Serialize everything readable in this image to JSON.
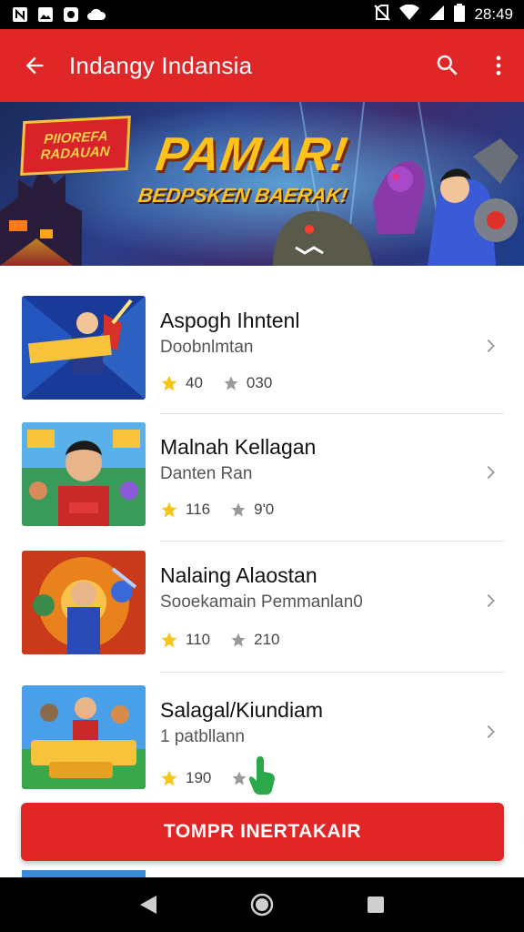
{
  "status_bar": {
    "time": "28:49",
    "left_icons": [
      "notification-n-icon",
      "image-icon",
      "video-icon",
      "cloud-icon"
    ],
    "right_icons": [
      "no-sim-icon",
      "wifi-icon",
      "signal-icon",
      "battery-icon"
    ]
  },
  "app_bar": {
    "title": "Indangy Indansia",
    "back_icon": "arrow-left-icon",
    "search_icon": "search-icon",
    "more_icon": "more-vert-icon",
    "color": "#e02626"
  },
  "banner": {
    "badge_line1": "PIIOREFA",
    "badge_line2": "RADAUAN",
    "headline": "PAMAR!",
    "subline": "BEDPSKEN BAERAK!"
  },
  "games": [
    {
      "title": "Aspogh Ihntenl",
      "subtitle": "Doobnlmtan",
      "rating": "40",
      "downloads": "030"
    },
    {
      "title": "Malnah Kellagan",
      "subtitle": "Danten Ran",
      "rating": "116",
      "downloads": "9'0"
    },
    {
      "title": "Nalaing Alaostan",
      "subtitle": "Sooekamain Pemmanlan0",
      "rating": "110",
      "downloads": "210"
    },
    {
      "title": "Salagal/Kiundiam",
      "subtitle": "1 patbllann",
      "rating": "190",
      "downloads": "1"
    }
  ],
  "cta": {
    "label": "TOMPR INERTAKAIR"
  },
  "nav": {
    "back": "nav-back-icon",
    "home": "nav-home-icon",
    "recents": "nav-recents-icon"
  },
  "colors": {
    "accent": "#e02626",
    "star": "#f5c518"
  }
}
